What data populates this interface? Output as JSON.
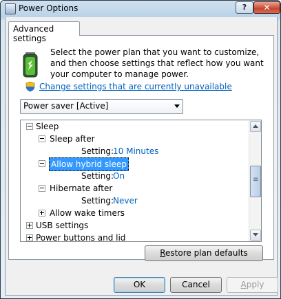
{
  "window": {
    "title": "Power Options",
    "help_label": "?",
    "close_label": "✕"
  },
  "tab": {
    "label": "Advanced settings"
  },
  "intro": {
    "text": "Select the power plan that you want to customize, and then choose settings that reflect how you want your computer to manage power."
  },
  "change_link": "Change settings that are currently unavailable",
  "plan_select": {
    "selected": "Power saver [Active]"
  },
  "tree": {
    "sleep": {
      "label": "Sleep"
    },
    "sleep_after": {
      "label": "Sleep after",
      "setting_label": "Setting:",
      "value": "10 Minutes"
    },
    "hybrid": {
      "label": "Allow hybrid sleep",
      "setting_label": "Setting:",
      "value": "On"
    },
    "hibernate": {
      "label": "Hibernate after",
      "setting_label": "Setting:",
      "value": "Never"
    },
    "wake_timers": {
      "label": "Allow wake timers"
    },
    "usb": {
      "label": "USB settings"
    },
    "power_buttons": {
      "label": "Power buttons and lid"
    }
  },
  "buttons": {
    "restore_pre": "R",
    "restore_rest": "estore plan defaults",
    "ok": "OK",
    "cancel": "Cancel",
    "apply_pre": "A",
    "apply_rest": "pply"
  },
  "colors": {
    "link": "#0060c0",
    "selection": "#3399ff"
  }
}
